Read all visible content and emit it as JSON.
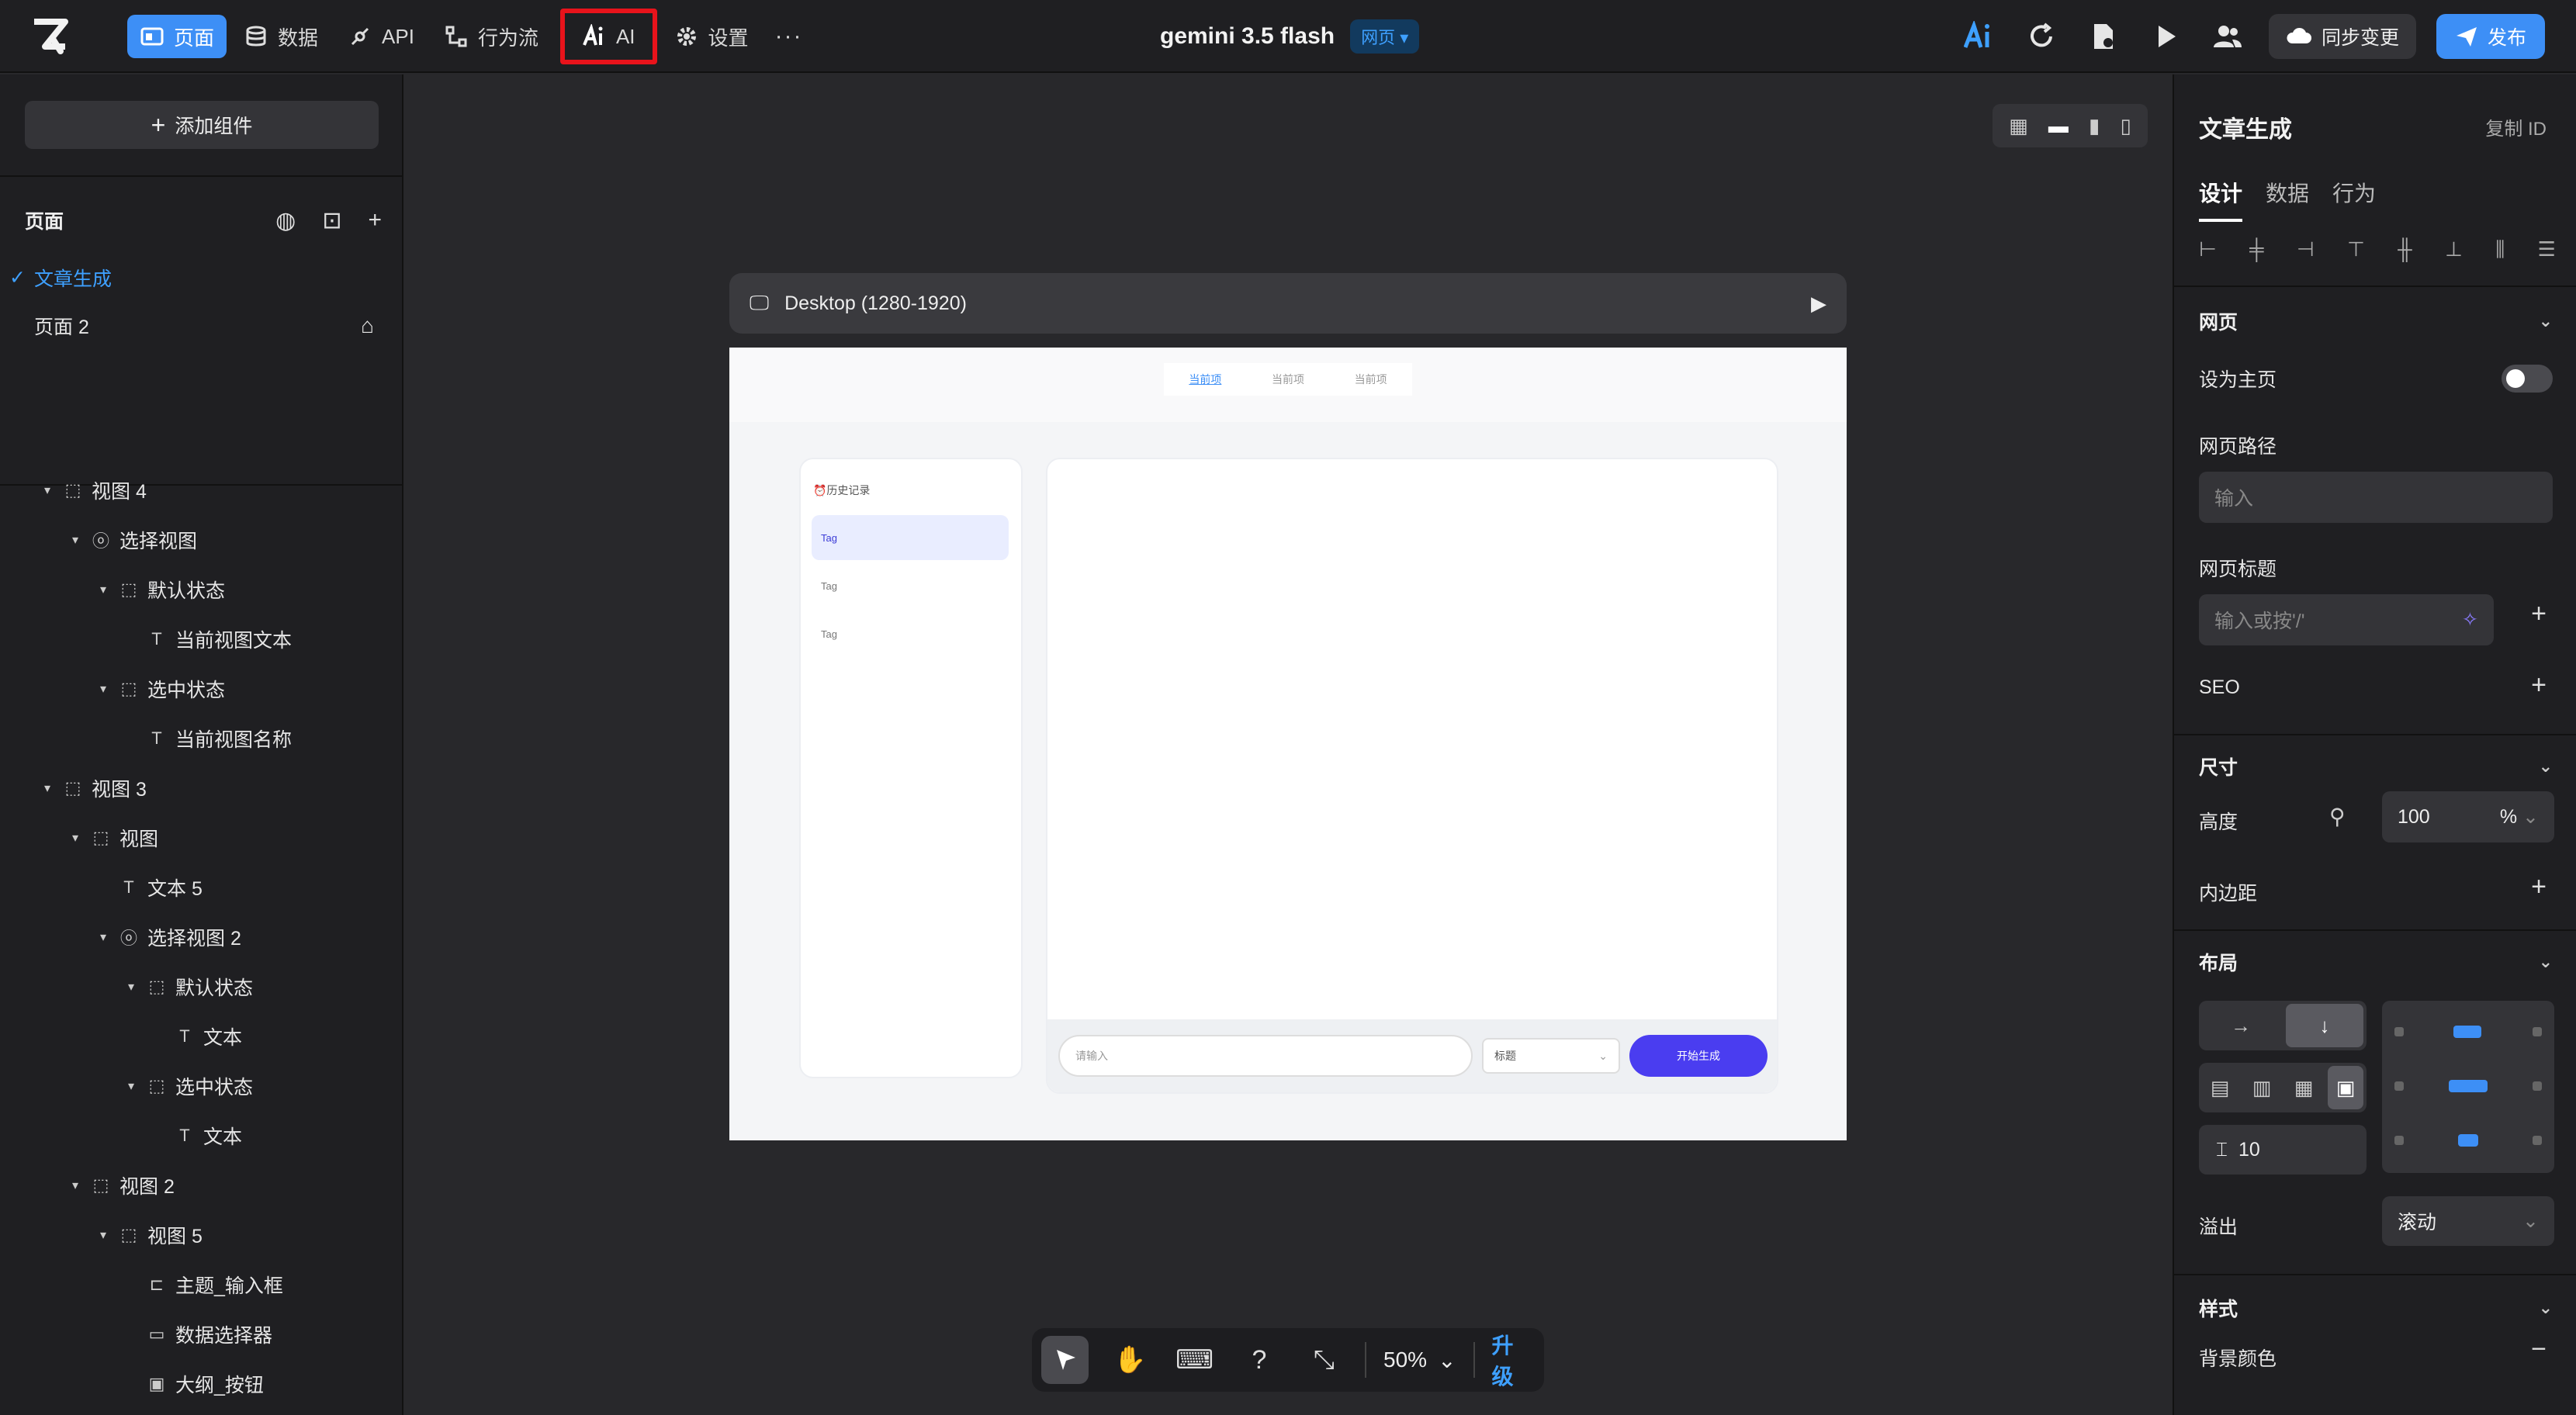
{
  "topbar": {
    "nav": [
      {
        "label": "页面",
        "icon": "page-icon",
        "active": true
      },
      {
        "label": "数据",
        "icon": "database-icon"
      },
      {
        "label": "API",
        "icon": "api-icon"
      },
      {
        "label": "行为流",
        "icon": "flow-icon"
      },
      {
        "label": "AI",
        "icon": "ai-icon"
      },
      {
        "label": "设置",
        "icon": "gear-icon"
      }
    ],
    "more": "···",
    "project_title": "gemini 3.5 flash",
    "project_badge": "网页 ▾",
    "sync_label": "同步变更",
    "publish_label": "发布"
  },
  "left": {
    "add_component": "添加组件",
    "pages_label": "页面",
    "pages": [
      {
        "label": "文章生成",
        "selected": true
      },
      {
        "label": "页面 2"
      }
    ],
    "tree": [
      {
        "label": "视图 4",
        "level": 0,
        "icon": "box"
      },
      {
        "label": "选择视图",
        "level": 1,
        "icon": "opt"
      },
      {
        "label": "默认状态",
        "level": 2,
        "icon": "box"
      },
      {
        "label": "当前视图文本",
        "level": 3,
        "icon": "text"
      },
      {
        "label": "选中状态",
        "level": 2,
        "icon": "box"
      },
      {
        "label": "当前视图名称",
        "level": 3,
        "icon": "text"
      },
      {
        "label": "视图 3",
        "level": 0,
        "icon": "box"
      },
      {
        "label": "视图",
        "level": 1,
        "icon": "box"
      },
      {
        "label": "文本 5",
        "level": 2,
        "icon": "text"
      },
      {
        "label": "选择视图 2",
        "level": 2,
        "icon": "opt"
      },
      {
        "label": "默认状态",
        "level": 3,
        "icon": "box"
      },
      {
        "label": "文本",
        "level": 4,
        "icon": "text"
      },
      {
        "label": "选中状态",
        "level": 3,
        "icon": "box"
      },
      {
        "label": "文本",
        "level": 4,
        "icon": "text"
      },
      {
        "label": "视图 2",
        "level": 1,
        "icon": "box"
      },
      {
        "label": "视图 5",
        "level": 2,
        "icon": "box"
      },
      {
        "label": "主题_输入框",
        "level": 3,
        "icon": "input"
      },
      {
        "label": "数据选择器",
        "level": 3,
        "icon": "select"
      },
      {
        "label": "大纲_按钮",
        "level": 3,
        "icon": "btn"
      }
    ]
  },
  "canvas": {
    "frame_label": "Desktop (1280-1920)",
    "preview": {
      "tabs": [
        "当前项",
        "当前项",
        "当前项"
      ],
      "history_label": "⏰历史记录",
      "tags": [
        "Tag",
        "Tag",
        "Tag"
      ],
      "input_placeholder": "请输入",
      "select_value": "标题",
      "generate_button": "开始生成"
    },
    "toolbar": {
      "zoom": "50%",
      "upgrade": "升级"
    }
  },
  "right": {
    "title": "文章生成",
    "copy_id": "复制 ID",
    "tabs": [
      "设计",
      "数据",
      "行为"
    ],
    "section_web": "网页",
    "set_home": "设为主页",
    "path_label": "网页路径",
    "path_placeholder": "输入",
    "page_title_label": "网页标题",
    "page_title_placeholder": "输入或按'/'",
    "seo_label": "SEO",
    "section_size": "尺寸",
    "height_label": "高度",
    "height_value": "100",
    "height_unit": "%",
    "padding_label": "内边距",
    "section_layout": "布局",
    "gap_value": "10",
    "overflow_label": "溢出",
    "overflow_value": "滚动",
    "section_style": "样式",
    "bg_color_label": "背景颜色"
  }
}
